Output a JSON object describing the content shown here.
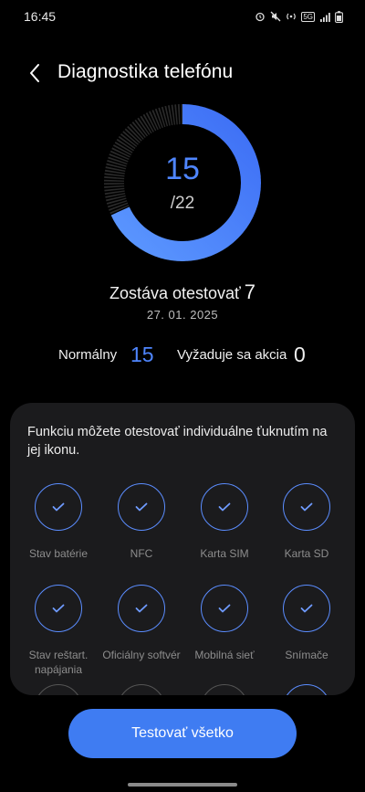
{
  "status_bar": {
    "time": "16:45",
    "network_badge": "5G"
  },
  "header": {
    "title": "Diagnostika telefónu"
  },
  "progress": {
    "tested": 15,
    "total": 22,
    "total_label": "/22",
    "accent_color": "#4f86ff",
    "track_color": "#2a2a2a"
  },
  "remaining": {
    "label": "Zostáva otestovať",
    "count": "7"
  },
  "date": "27. 01. 2025",
  "summary": {
    "normal_label": "Normálny",
    "normal_count": "15",
    "action_label": "Vyžaduje sa akcia",
    "action_count": "0"
  },
  "panel": {
    "hint": "Funkciu môžete otestovať individuálne ťuknutím na jej ikonu.",
    "items": [
      {
        "label": "Stav batérie",
        "icon": "check-icon"
      },
      {
        "label": "NFC",
        "icon": "check-icon"
      },
      {
        "label": "Karta SIM",
        "icon": "check-icon"
      },
      {
        "label": "Karta SD",
        "icon": "check-icon"
      },
      {
        "label": "Stav reštart. napájania",
        "icon": "check-icon"
      },
      {
        "label": "Oficiálny softvér",
        "icon": "check-icon"
      },
      {
        "label": "Mobilná sieť",
        "icon": "check-icon"
      },
      {
        "label": "Snímače",
        "icon": "check-icon"
      }
    ]
  },
  "actions": {
    "test_all_label": "Testovať všetko"
  }
}
